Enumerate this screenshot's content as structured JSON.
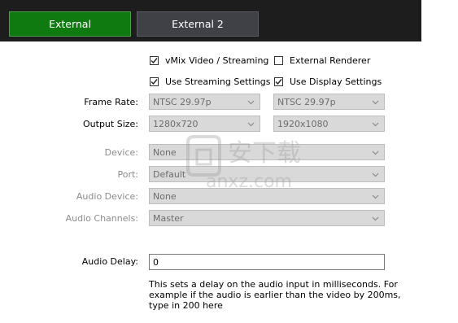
{
  "tabs": [
    {
      "label": "External",
      "active": true
    },
    {
      "label": "External 2",
      "active": false
    }
  ],
  "checkboxes": {
    "vmix_video": {
      "label": "vMix Video / Streaming",
      "checked": true
    },
    "external_renderer": {
      "label": "External Renderer",
      "checked": false
    },
    "use_streaming": {
      "label": "Use Streaming Settings",
      "checked": true
    },
    "use_display": {
      "label": "Use Display Settings",
      "checked": true
    }
  },
  "labels": {
    "frame_rate": "Frame Rate:",
    "output_size": "Output Size:",
    "device": "Device:",
    "port": "Port:",
    "audio_device": "Audio Device:",
    "audio_channels": "Audio Channels:",
    "audio_delay": "Audio Delay:"
  },
  "selects": {
    "frame_rate_1": "NTSC 29.97p",
    "frame_rate_2": "NTSC 29.97p",
    "output_size_1": "1280x720",
    "output_size_2": "1920x1080",
    "device": "None",
    "port": "Default",
    "audio_device": "None",
    "audio_channels": "Master"
  },
  "audio_delay_value": "0",
  "note": "This sets a delay on the audio input in milliseconds. For example if the audio is earlier than the video by 200ms, type in 200 here",
  "watermark_text": "安下载 anxz.com",
  "colors": {
    "active_tab": "#0f7a10",
    "inactive_tab": "#3f4146",
    "topbar": "#1d1d1d"
  }
}
